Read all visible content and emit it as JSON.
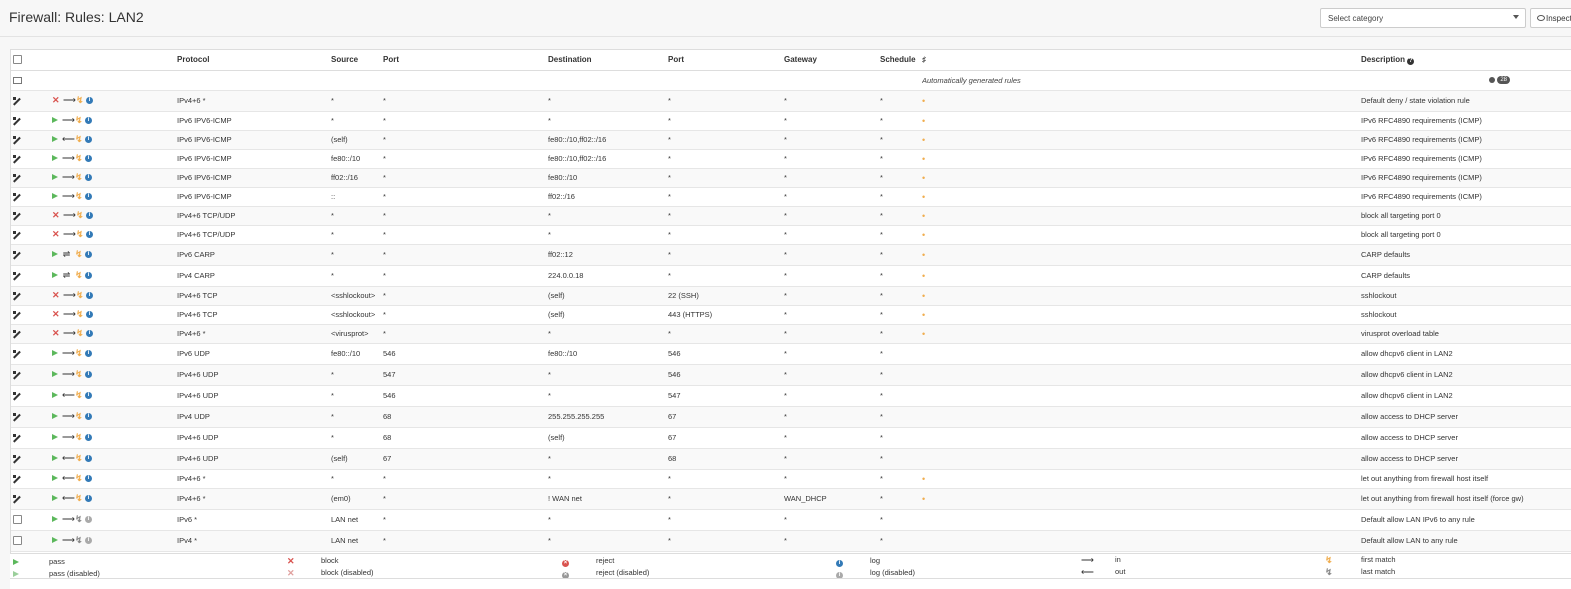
{
  "page": {
    "title": "Firewall: Rules: LAN2"
  },
  "category_select": {
    "value": "Select category"
  },
  "inspect_button": {
    "label": "Inspect"
  },
  "columns": [
    "Protocol",
    "Source",
    "Port",
    "Destination",
    "Port",
    "Gateway",
    "Schedule",
    "",
    "Description"
  ],
  "group_row": {
    "description": "Automatically generated rules",
    "badge": "28"
  },
  "rules": [
    {
      "action": "block",
      "dir": "in",
      "proto": "IPv4+6 *",
      "source": "*",
      "sport": "*",
      "dest": "*",
      "dport": "*",
      "gw": "*",
      "sched": "*",
      "cat": "•",
      "desc": "Default deny / state violation rule",
      "btn": "none"
    },
    {
      "action": "pass",
      "dir": "in",
      "proto": "IPv6 IPV6-ICMP",
      "source": "*",
      "sport": "*",
      "dest": "*",
      "dport": "*",
      "gw": "*",
      "sched": "*",
      "cat": "•",
      "desc": "IPv6 RFC4890 requirements (ICMP)",
      "btn": "none"
    },
    {
      "action": "pass",
      "dir": "out",
      "proto": "IPv6 IPV6-ICMP",
      "source": "(self)",
      "sport": "*",
      "dest": "fe80::/10,ff02::/16",
      "dport": "*",
      "gw": "*",
      "sched": "*",
      "cat": "•",
      "desc": "IPv6 RFC4890 requirements (ICMP)",
      "btn": "none"
    },
    {
      "action": "pass",
      "dir": "in",
      "proto": "IPv6 IPV6-ICMP",
      "source": "fe80::/10",
      "sport": "*",
      "dest": "fe80::/10,ff02::/16",
      "dport": "*",
      "gw": "*",
      "sched": "*",
      "cat": "•",
      "desc": "IPv6 RFC4890 requirements (ICMP)",
      "btn": "none"
    },
    {
      "action": "pass",
      "dir": "in",
      "proto": "IPv6 IPV6-ICMP",
      "source": "ff02::/16",
      "sport": "*",
      "dest": "fe80::/10",
      "dport": "*",
      "gw": "*",
      "sched": "*",
      "cat": "•",
      "desc": "IPv6 RFC4890 requirements (ICMP)",
      "btn": "none"
    },
    {
      "action": "pass",
      "dir": "in",
      "proto": "IPv6 IPV6-ICMP",
      "source": "::",
      "sport": "*",
      "dest": "ff02::/16",
      "dport": "*",
      "gw": "*",
      "sched": "*",
      "cat": "•",
      "desc": "IPv6 RFC4890 requirements (ICMP)",
      "btn": "none"
    },
    {
      "action": "block",
      "dir": "in",
      "proto": "IPv4+6 TCP/UDP",
      "source": "*",
      "sport": "*",
      "dest": "*",
      "dport": "*",
      "gw": "*",
      "sched": "*",
      "cat": "•",
      "desc": "block all targeting port 0",
      "btn": "none"
    },
    {
      "action": "block",
      "dir": "in",
      "proto": "IPv4+6 TCP/UDP",
      "source": "*",
      "sport": "*",
      "dest": "*",
      "dport": "*",
      "gw": "*",
      "sched": "*",
      "cat": "•",
      "desc": "block all targeting port 0",
      "btn": "none"
    },
    {
      "action": "pass",
      "dir": "any",
      "proto": "IPv6 CARP",
      "source": "*",
      "sport": "*",
      "dest": "ff02::12",
      "dport": "*",
      "gw": "*",
      "sched": "*",
      "cat": "•",
      "desc": "CARP defaults",
      "btn": "search"
    },
    {
      "action": "pass",
      "dir": "any",
      "proto": "IPv4 CARP",
      "source": "*",
      "sport": "*",
      "dest": "224.0.0.18",
      "dport": "*",
      "gw": "*",
      "sched": "*",
      "cat": "•",
      "desc": "CARP defaults",
      "btn": "search"
    },
    {
      "action": "block",
      "dir": "in",
      "proto": "IPv4+6 TCP",
      "source": "<sshlockout>",
      "sport": "*",
      "dest": "(self)",
      "dport": "22 (SSH)",
      "gw": "*",
      "sched": "*",
      "cat": "•",
      "desc": "sshlockout",
      "btn": "none"
    },
    {
      "action": "block",
      "dir": "in",
      "proto": "IPv4+6 TCP",
      "source": "<sshlockout>",
      "sport": "*",
      "dest": "(self)",
      "dport": "443 (HTTPS)",
      "gw": "*",
      "sched": "*",
      "cat": "•",
      "desc": "sshlockout",
      "btn": "none"
    },
    {
      "action": "block",
      "dir": "in",
      "proto": "IPv4+6 *",
      "source": "<virusprot>",
      "sport": "*",
      "dest": "*",
      "dport": "*",
      "gw": "*",
      "sched": "*",
      "cat": "•",
      "desc": "virusprot overload table",
      "btn": "none"
    },
    {
      "action": "pass",
      "dir": "in",
      "proto": "IPv6 UDP",
      "source": "fe80::/10",
      "sport": "546",
      "dest": "fe80::/10",
      "dport": "546",
      "gw": "*",
      "sched": "*",
      "cat": "",
      "desc": "allow dhcpv6 client in LAN2",
      "btn": "search"
    },
    {
      "action": "pass",
      "dir": "in",
      "proto": "IPv4+6 UDP",
      "source": "*",
      "sport": "547",
      "dest": "*",
      "dport": "546",
      "gw": "*",
      "sched": "*",
      "cat": "",
      "desc": "allow dhcpv6 client in LAN2",
      "btn": "search"
    },
    {
      "action": "pass",
      "dir": "out",
      "proto": "IPv4+6 UDP",
      "source": "*",
      "sport": "546",
      "dest": "*",
      "dport": "547",
      "gw": "*",
      "sched": "*",
      "cat": "",
      "desc": "allow dhcpv6 client in LAN2",
      "btn": "search"
    },
    {
      "action": "pass",
      "dir": "in",
      "proto": "IPv4 UDP",
      "source": "*",
      "sport": "68",
      "dest": "255.255.255.255",
      "dport": "67",
      "gw": "*",
      "sched": "*",
      "cat": "",
      "desc": "allow access to DHCP server",
      "btn": "search"
    },
    {
      "action": "pass",
      "dir": "in",
      "proto": "IPv4+6 UDP",
      "source": "*",
      "sport": "68",
      "dest": "(self)",
      "dport": "67",
      "gw": "*",
      "sched": "*",
      "cat": "",
      "desc": "allow access to DHCP server",
      "btn": "search"
    },
    {
      "action": "pass",
      "dir": "out",
      "proto": "IPv4+6 UDP",
      "source": "(self)",
      "sport": "67",
      "dest": "*",
      "dport": "68",
      "gw": "*",
      "sched": "*",
      "cat": "",
      "desc": "allow access to DHCP server",
      "btn": "search"
    },
    {
      "action": "pass",
      "dir": "out",
      "proto": "IPv4+6 *",
      "source": "*",
      "sport": "*",
      "dest": "*",
      "dport": "*",
      "gw": "*",
      "sched": "*",
      "cat": "•",
      "desc": "let out anything from firewall host itself",
      "btn": "none"
    },
    {
      "action": "pass",
      "dir": "out",
      "proto": "IPv4+6 *",
      "source": "(em0)",
      "sport": "*",
      "dest": "! WAN net",
      "dport": "*",
      "gw": "WAN_DHCP",
      "sched": "*",
      "cat": "•",
      "desc": "let out anything from firewall host itself (force gw)",
      "btn": "search"
    },
    {
      "action": "pass",
      "dir": "in",
      "proto": "IPv6 *",
      "source": "LAN net",
      "sport": "*",
      "dest": "*",
      "dport": "*",
      "gw": "*",
      "sched": "*",
      "cat": "",
      "desc": "Default allow LAN IPv6 to any rule",
      "btn": "edit"
    },
    {
      "action": "pass",
      "dir": "in",
      "proto": "IPv4 *",
      "source": "LAN net",
      "sport": "*",
      "dest": "*",
      "dport": "*",
      "gw": "*",
      "sched": "*",
      "cat": "",
      "desc": "Default allow LAN to any rule",
      "btn": "edit"
    }
  ],
  "legend": {
    "pass": "pass",
    "pass_disabled": "pass (disabled)",
    "block": "block",
    "block_disabled": "block (disabled)",
    "reject": "reject",
    "reject_disabled": "reject (disabled)",
    "log": "log",
    "log_disabled": "log (disabled)",
    "in": "in",
    "out": "out",
    "first": "first match",
    "last": "last match"
  }
}
